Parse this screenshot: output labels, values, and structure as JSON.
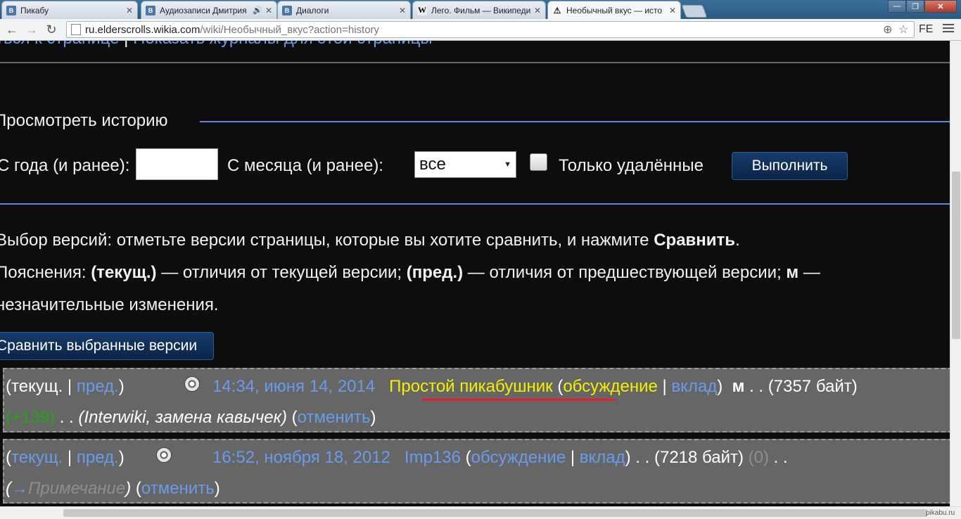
{
  "tabs": [
    {
      "title": "Пикабу",
      "favicon": "В",
      "favicon_color": "#4a76a8"
    },
    {
      "title": "Аудиозаписи Дмитрия",
      "favicon": "В",
      "favicon_color": "#4a76a8",
      "audio": "🔊"
    },
    {
      "title": "Диалоги",
      "favicon": "В",
      "favicon_color": "#4a76a8"
    },
    {
      "title": "Лего. Фильм — Википеди",
      "favicon": "W",
      "favicon_color": "#eeeeee"
    },
    {
      "title": "Необычный вкус — исто",
      "favicon": "⚠",
      "favicon_color": "#ffffff",
      "active": true
    }
  ],
  "window": {
    "minimize": "—",
    "maximize": "❐",
    "close": "✕"
  },
  "toolbar": {
    "url_host": "ru.elderscrolls.wikia.com",
    "url_path": "/wiki/Необычный_вкус?action=history",
    "extension": "FE"
  },
  "page": {
    "top_links_a": "ться к странице",
    "top_links_sep": " | ",
    "top_links_b": "Показать журналы для этой страницы",
    "legend": "Просмотреть историю",
    "label_year": "С года (и ранее):",
    "label_month": "С месяца (и ранее):",
    "month_value": "все",
    "label_deleted": "Только удалённые",
    "submit": "Выполнить",
    "help1_a": "Выбор версий: отметьте версии страницы, которые вы хотите сравнить, и нажмите ",
    "help1_b": "Сравнить",
    "help1_c": ".",
    "help2_a": "Пояснения: ",
    "help2_cur": "(текущ.)",
    "help2_b": " — отличия от текущей версии; ",
    "help2_prev": "(пред.)",
    "help2_c": " — отличия от предшествующей версии; ",
    "help2_m": "м",
    "help2_d": " —",
    "help3": "незначительные изменения.",
    "compare_button": "Сравнить выбранные версии"
  },
  "revisions": [
    {
      "cur": "текущ.",
      "prev": "пред.",
      "sep": " | ",
      "timestamp": "14:34, июня 14, 2014",
      "user": "Простой пикабушник",
      "talk": "обсуждение",
      "contribs": "вклад",
      "minor": "м",
      "size": "(7357 байт)",
      "diff": "(+139)",
      "summary": "(Interwiki, замена кавычек)",
      "undo": "отменить"
    },
    {
      "cur": "текущ.",
      "prev": "пред.",
      "sep": " | ",
      "timestamp": "16:52, ноября 18, 2012",
      "user": "Imp136",
      "talk": "обсуждение",
      "contribs": "вклад",
      "size": "(7218 байт)",
      "diff": "(0)",
      "arrow": "→",
      "section": "Примечание",
      "undo": "отменить"
    }
  ],
  "watermark": "pikabu.ru"
}
